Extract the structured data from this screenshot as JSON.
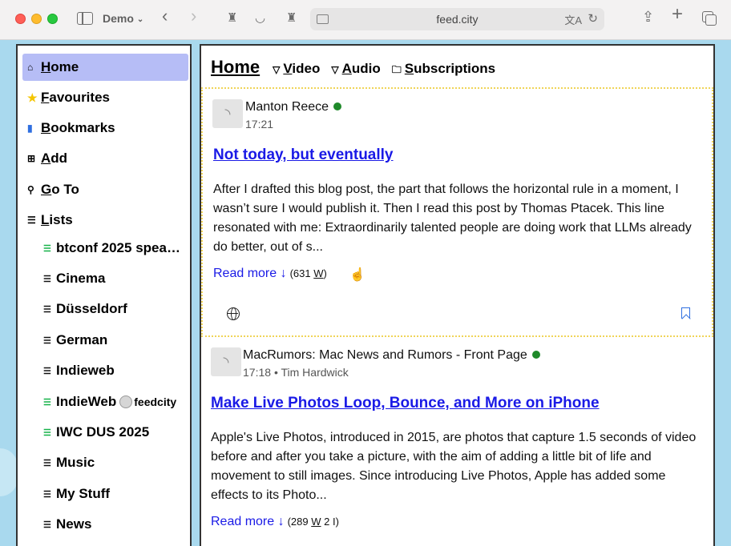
{
  "browser": {
    "profile": "Demo",
    "url": "feed.city"
  },
  "sidebar": {
    "nav": [
      {
        "icon": "home-icon",
        "glyph": "⌂",
        "underline": "H",
        "rest": "ome"
      },
      {
        "icon": "star-icon",
        "glyph": "★",
        "underline": "F",
        "rest": "avourites"
      },
      {
        "icon": "bookmark-icon",
        "glyph": "▮",
        "underline": "B",
        "rest": "ookmarks"
      },
      {
        "icon": "add-icon",
        "glyph": "⊞",
        "underline": "A",
        "rest": "dd"
      },
      {
        "icon": "search-icon",
        "glyph": "⚲",
        "underline": "G",
        "rest": "o To"
      },
      {
        "icon": "list-icon",
        "glyph": "☰",
        "underline": "L",
        "rest": "ists"
      }
    ],
    "lists": [
      {
        "label": "btconf 2025 spea…",
        "green": true
      },
      {
        "label": "Cinema",
        "green": false
      },
      {
        "label": "Düsseldorf",
        "green": false
      },
      {
        "label": "German",
        "green": false
      },
      {
        "label": "Indieweb",
        "green": false
      },
      {
        "label": "IndieWeb",
        "badge": "feedcity",
        "green": true
      },
      {
        "label": "IWC DUS 2025",
        "green": true
      },
      {
        "label": "Music",
        "green": false
      },
      {
        "label": "My Stuff",
        "green": false
      },
      {
        "label": "News",
        "green": false
      }
    ]
  },
  "main": {
    "title": "Home",
    "filters": [
      {
        "icon": "filter-icon",
        "glyph": "▽",
        "underline": "V",
        "rest": "ideo"
      },
      {
        "icon": "filter-icon",
        "glyph": "▽",
        "underline": "A",
        "rest": "udio"
      },
      {
        "icon": "folder-icon",
        "glyph": "🗀",
        "underline": "S",
        "rest": "ubscriptions"
      }
    ],
    "posts": [
      {
        "source": "Manton Reece",
        "time": "17:21",
        "author": "",
        "title": "Not today, but eventually",
        "excerpt": "After I drafted this blog post, the part that follows the horizontal rule in a moment, I wasn’t sure I would publish it. Then I read this post by Thomas Ptacek. This line resonated with me: Extraordinarily talented people are doing work that LLMs already do better, out of s...",
        "read_more": "Read more ↓",
        "word_count_num": "(631 ",
        "word_count_unit": "W",
        "word_count_end": ")"
      },
      {
        "source": "MacRumors: Mac News and Rumors - Front Page",
        "time": "17:18",
        "author": "• Tim Hardwick",
        "title": "Make Live Photos Loop, Bounce, and More on iPhone",
        "excerpt": "Apple's Live Photos, introduced in 2015, are photos that capture 1.5 seconds of video before and after you take a picture, with the aim of adding a little bit of life and movement to still images. Since introducing Live Photos, Apple has added some effects to its Photo...",
        "read_more": "Read more ↓",
        "word_count_num": "(289 ",
        "word_count_unit": "W",
        "word_count_end": " 2 I)"
      }
    ]
  }
}
